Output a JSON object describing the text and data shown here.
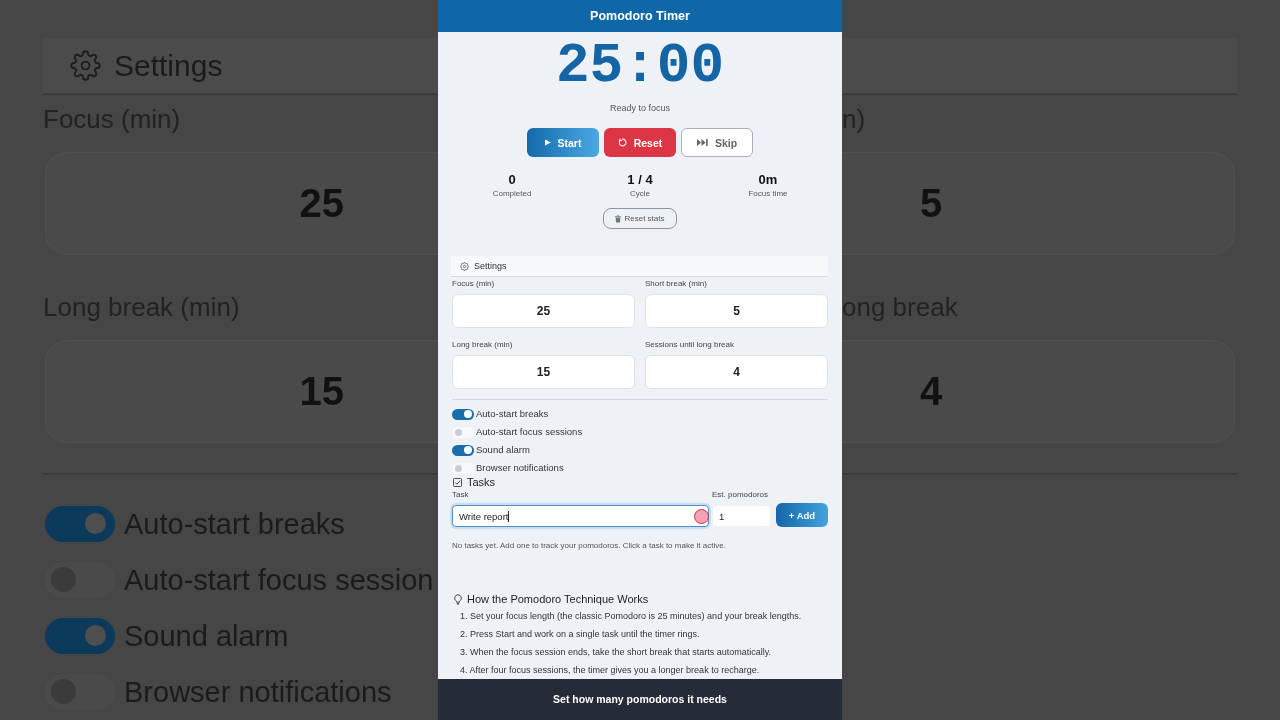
{
  "backdrop": {
    "left": {
      "section_title": "Settings",
      "fields": [
        {
          "label": "Focus (min)",
          "value": "25"
        },
        {
          "label": "Long break (min)",
          "value": "15"
        }
      ],
      "toggles": [
        {
          "label": "Auto-start breaks",
          "on": true
        },
        {
          "label": "Auto-start focus session",
          "on": false
        },
        {
          "label": "Sound alarm",
          "on": true
        },
        {
          "label": "Browser notifications",
          "on": false
        }
      ]
    },
    "right": {
      "fields": [
        {
          "label": "n)",
          "value": "5"
        },
        {
          "label": "ong break",
          "value": "4"
        }
      ]
    }
  },
  "app": {
    "title": "Pomodoro Timer",
    "timer": {
      "time": "25:00",
      "status": "Ready to focus"
    },
    "controls": [
      {
        "kind": "start",
        "label": "Start"
      },
      {
        "kind": "reset",
        "label": "Reset"
      },
      {
        "kind": "skip",
        "label": "Skip"
      }
    ],
    "stats": [
      {
        "value": "0",
        "label": "Completed"
      },
      {
        "value": "1 / 4",
        "label": "Cycle"
      },
      {
        "value": "0m",
        "label": "Focus time"
      }
    ],
    "reset_stats": "Reset stats",
    "settings": {
      "title": "Settings",
      "fields": [
        {
          "label": "Focus (min)",
          "value": "25"
        },
        {
          "label": "Short break (min)",
          "value": "5"
        },
        {
          "label": "Long break (min)",
          "value": "15"
        },
        {
          "label": "Sessions until long break",
          "value": "4"
        }
      ],
      "toggles": [
        {
          "label": "Auto-start breaks",
          "on": true
        },
        {
          "label": "Auto-start focus sessions",
          "on": false
        },
        {
          "label": "Sound alarm",
          "on": true
        },
        {
          "label": "Browser notifications",
          "on": false
        }
      ]
    },
    "tasks": {
      "title": "Tasks",
      "task_label": "Task",
      "task_value": "Write report",
      "estimate_label": "Est. pomodoros",
      "estimate_value": "1",
      "add_button": "+ Add",
      "empty_message": "No tasks yet. Add one to track your pomodoros. Click a task to make it active."
    },
    "guide": {
      "title": "How the Pomodoro Technique Works",
      "steps": [
        "1. Set your focus length (the classic Pomodoro is 25 minutes) and your break lengths.",
        "2. Press Start and work on a single task until the timer rings.",
        "3. When the focus session ends, take the short break that starts automatically.",
        "4. After four focus sessions, the timer gives you a longer break to recharge."
      ]
    }
  },
  "caption": "Set how many pomodoros it needs"
}
